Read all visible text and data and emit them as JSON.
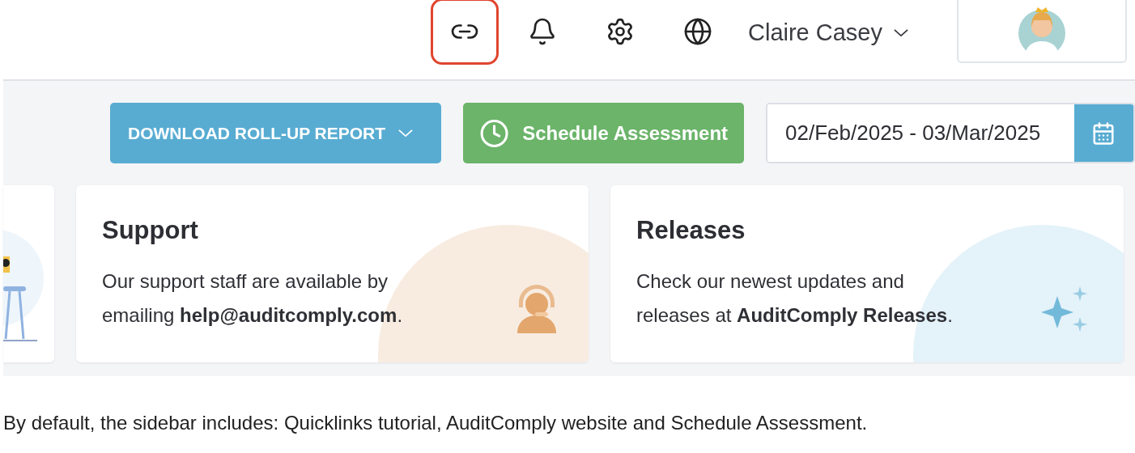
{
  "header": {
    "icons": [
      {
        "kind": "link",
        "highlighted": true
      },
      {
        "kind": "bell",
        "highlighted": false
      },
      {
        "kind": "settings",
        "highlighted": false
      },
      {
        "kind": "globe",
        "highlighted": false
      }
    ],
    "user": {
      "name": "Claire Casey"
    }
  },
  "actions": {
    "download_button": {
      "label": "DOWNLOAD ROLL-UP REPORT"
    },
    "schedule_button": {
      "label": "Schedule Assessment"
    },
    "date_range": {
      "value": "02/Feb/2025 - 03/Mar/2025"
    }
  },
  "cards": [
    {
      "kind": "support",
      "title": "Support",
      "body": "Our support staff are available by emailing **help@auditcomply.com**."
    },
    {
      "kind": "releases",
      "title": "Releases",
      "body": "Check our newest updates and releases at **AuditComply Releases**."
    }
  ],
  "caption": "By default, the sidebar includes: Quicklinks tutorial, AuditComply website and Schedule Assessment."
}
